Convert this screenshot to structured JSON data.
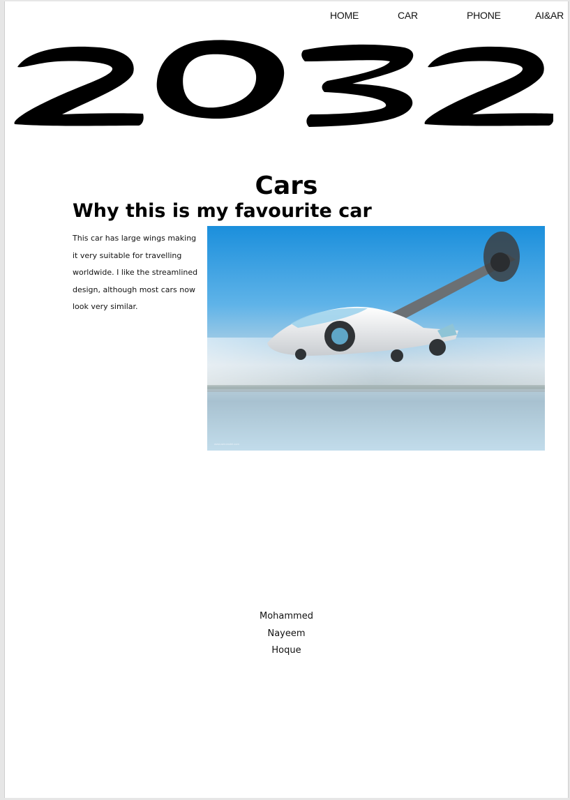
{
  "nav": {
    "items": [
      {
        "label": "HOME"
      },
      {
        "label": "CAR"
      },
      {
        "label": "PHONE"
      },
      {
        "label": "AI&AR"
      }
    ]
  },
  "logo": {
    "text": "2032"
  },
  "main": {
    "title": "Cars",
    "subtitle": "Why this is my favourite car",
    "paragraph": "This car has large wings making it very suitable for travelling worldwide. I like the streamlined design, although most cars now look very similar.",
    "image": {
      "caption": "www.aeromobil.com"
    }
  },
  "footer": {
    "author_lines": [
      "Mohammed",
      "Nayeem",
      "Hoque"
    ]
  }
}
